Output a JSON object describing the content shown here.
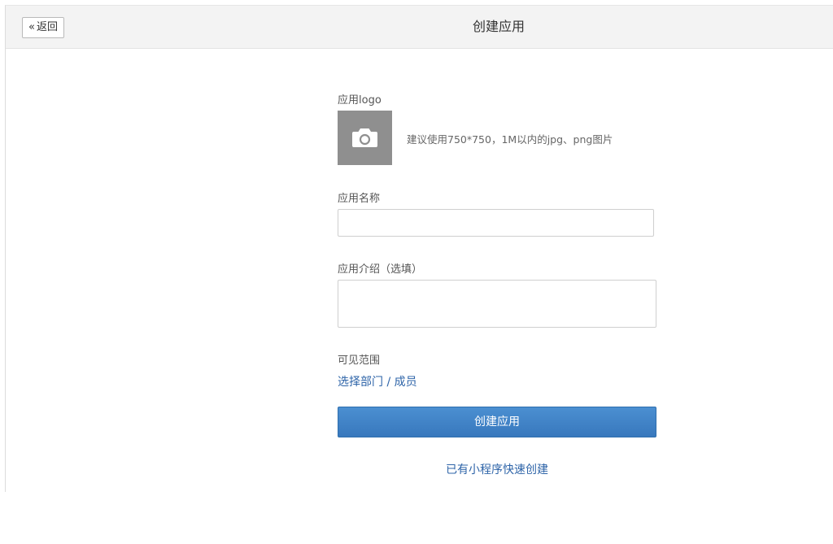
{
  "header": {
    "back_label": "返回",
    "back_chevron": "«",
    "title": "创建应用"
  },
  "form": {
    "logo_label": "应用logo",
    "logo_icon": "camera-icon",
    "logo_hint": "建议使用750*750，1M以内的jpg、png图片",
    "name_label": "应用名称",
    "name_value": "",
    "desc_label": "应用介绍（选填）",
    "desc_value": "",
    "visibility_label": "可见范围",
    "visibility_link": "选择部门 / 成员",
    "submit_label": "创建应用",
    "quick_create_link": "已有小程序快速创建"
  },
  "colors": {
    "primary_button": "#3a7cc1",
    "link": "#2e64a8",
    "logo_placeholder": "#8f8f8f"
  }
}
